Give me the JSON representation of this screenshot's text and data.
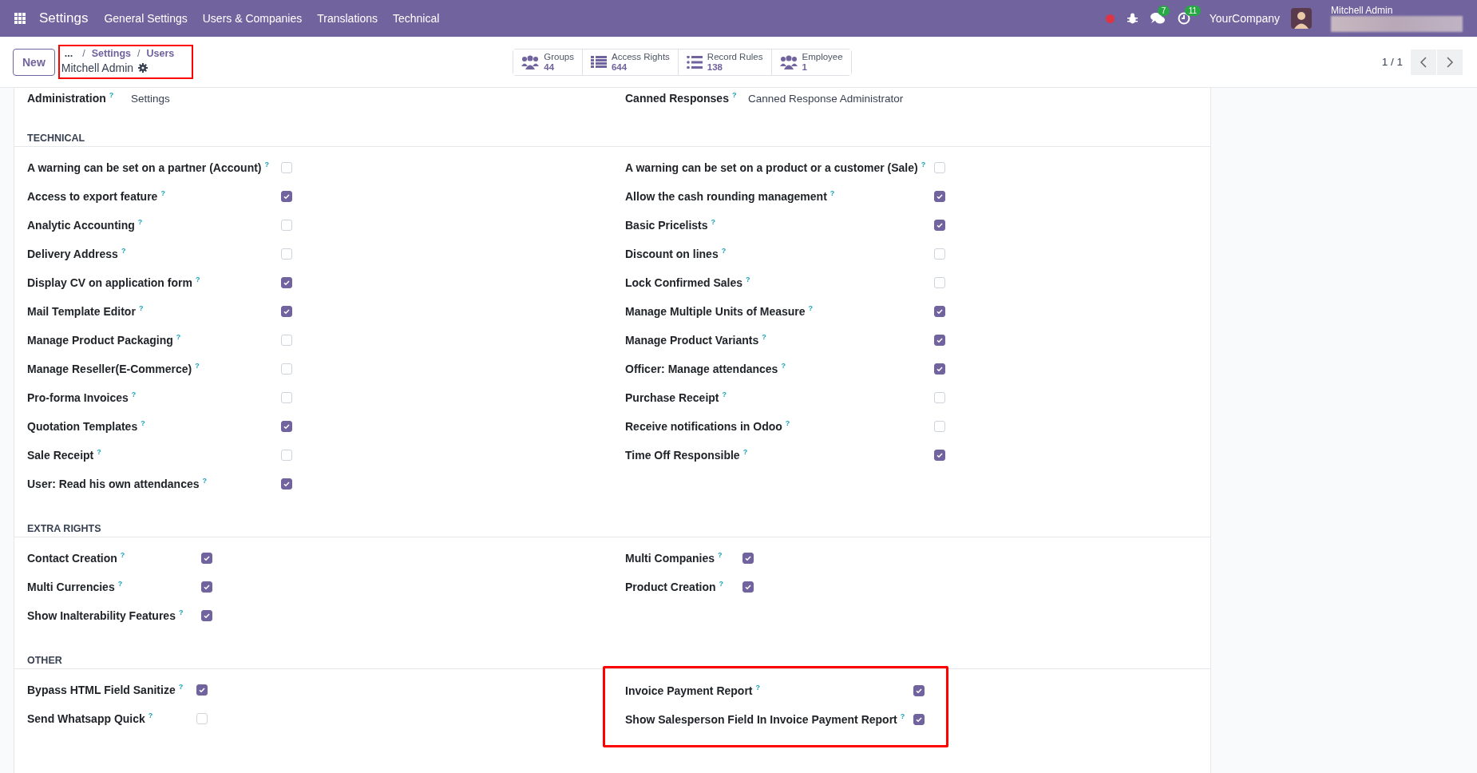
{
  "navbar": {
    "app_title": "Settings",
    "menus": [
      "General Settings",
      "Users & Companies",
      "Translations",
      "Technical"
    ],
    "chat_count": "7",
    "activity_count": "11",
    "company": "YourCompany",
    "user_name": "Mitchell Admin"
  },
  "control_panel": {
    "new_button": "New",
    "breadcrumb": {
      "highlighted": true,
      "ellipsis": "...",
      "items": [
        {
          "separator": "/",
          "text": "Settings"
        },
        {
          "separator": "/",
          "text": "Users"
        }
      ],
      "record": "Mitchell Admin"
    },
    "stat_buttons": [
      {
        "kind": "people",
        "label": "Groups",
        "value": "44"
      },
      {
        "kind": "list",
        "label": "Access Rights",
        "value": "644"
      },
      {
        "kind": "bullets",
        "label": "Record Rules",
        "value": "138"
      },
      {
        "kind": "people",
        "label": "Employee",
        "value": "1"
      }
    ],
    "pager": "1 / 1"
  },
  "top_fields": [
    {
      "label": "Administration",
      "help": "?",
      "value": "Settings"
    },
    {
      "label": "Canned Responses",
      "help": "?",
      "value": "Canned Response Administrator"
    }
  ],
  "sections": [
    {
      "title": "TECHNICAL",
      "left": [
        {
          "label": "A warning can be set on a partner (Account)",
          "help": "?",
          "checked": false
        },
        {
          "label": "Access to export feature",
          "help": "?",
          "checked": true
        },
        {
          "label": "Analytic Accounting",
          "help": "?",
          "checked": false
        },
        {
          "label": "Delivery Address",
          "help": "?",
          "checked": false
        },
        {
          "label": "Display CV on application form",
          "help": "?",
          "checked": true
        },
        {
          "label": "Mail Template Editor",
          "help": "?",
          "checked": true
        },
        {
          "label": "Manage Product Packaging",
          "help": "?",
          "checked": false
        },
        {
          "label": "Manage Reseller(E-Commerce)",
          "help": "?",
          "checked": false
        },
        {
          "label": "Pro-forma Invoices",
          "help": "?",
          "checked": false
        },
        {
          "label": "Quotation Templates",
          "help": "?",
          "checked": true
        },
        {
          "label": "Sale Receipt",
          "help": "?",
          "checked": false
        },
        {
          "label": "User: Read his own attendances",
          "help": "?",
          "checked": true
        }
      ],
      "right": [
        {
          "label": "A warning can be set on a product or a customer (Sale)",
          "help": "?",
          "checked": false
        },
        {
          "label": "Allow the cash rounding management",
          "help": "?",
          "checked": true
        },
        {
          "label": "Basic Pricelists",
          "help": "?",
          "checked": true
        },
        {
          "label": "Discount on lines",
          "help": "?",
          "checked": false
        },
        {
          "label": "Lock Confirmed Sales",
          "help": "?",
          "checked": false
        },
        {
          "label": "Manage Multiple Units of Measure",
          "help": "?",
          "checked": true
        },
        {
          "label": "Manage Product Variants",
          "help": "?",
          "checked": true
        },
        {
          "label": "Officer: Manage attendances",
          "help": "?",
          "checked": true
        },
        {
          "label": "Purchase Receipt",
          "help": "?",
          "checked": false
        },
        {
          "label": "Receive notifications in Odoo",
          "help": "?",
          "checked": false
        },
        {
          "label": "Time Off Responsible",
          "help": "?",
          "checked": true
        }
      ]
    },
    {
      "title": "EXTRA RIGHTS",
      "left": [
        {
          "label": "Contact Creation",
          "help": "?",
          "checked": true
        },
        {
          "label": "Multi Currencies",
          "help": "?",
          "checked": true
        },
        {
          "label": "Show Inalterability Features",
          "help": "?",
          "checked": true
        }
      ],
      "right": [
        {
          "label": "Multi Companies",
          "help": "?",
          "checked": true
        },
        {
          "label": "Product Creation",
          "help": "?",
          "checked": true
        }
      ]
    },
    {
      "title": "OTHER",
      "right_highlighted": true,
      "left": [
        {
          "label": "Bypass HTML Field Sanitize",
          "help": "?",
          "checked": true
        },
        {
          "label": "Send Whatsapp Quick",
          "help": "?",
          "checked": false
        }
      ],
      "right": [
        {
          "label": "Invoice Payment Report",
          "help": "?",
          "checked": true
        },
        {
          "label": "Show Salesperson Field In Invoice Payment Report",
          "help": "?",
          "checked": true
        }
      ]
    }
  ]
}
